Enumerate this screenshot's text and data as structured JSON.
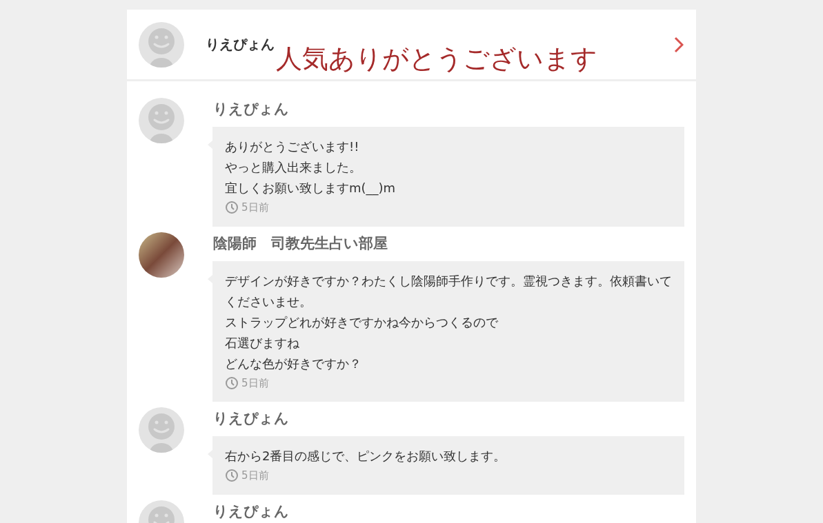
{
  "header": {
    "name": "りえぴょん",
    "caption": "人気ありがとうございます",
    "photo": false
  },
  "messages": [
    {
      "name": "りえぴょん",
      "photo": false,
      "lines": [
        "ありがとうございます!!",
        "やっと購入出来ました。",
        "宜しくお願い致しますm(__)m"
      ],
      "time": "5日前"
    },
    {
      "name": "陰陽師　司教先生占い部屋",
      "photo": true,
      "lines": [
        "デザインが好きですか？わたくし陰陽師手作りです。霊視つきます。依頼書いてくださいませ。",
        "ストラップどれが好きですかね今からつくるので",
        "石選びますね",
        "どんな色が好きですか？"
      ],
      "time": "5日前"
    },
    {
      "name": "りえぴょん",
      "photo": false,
      "lines": [
        "右から2番目の感じで、ピンクをお願い致します。"
      ],
      "time": "5日前"
    },
    {
      "name": "りえぴょん",
      "photo": false
    }
  ]
}
